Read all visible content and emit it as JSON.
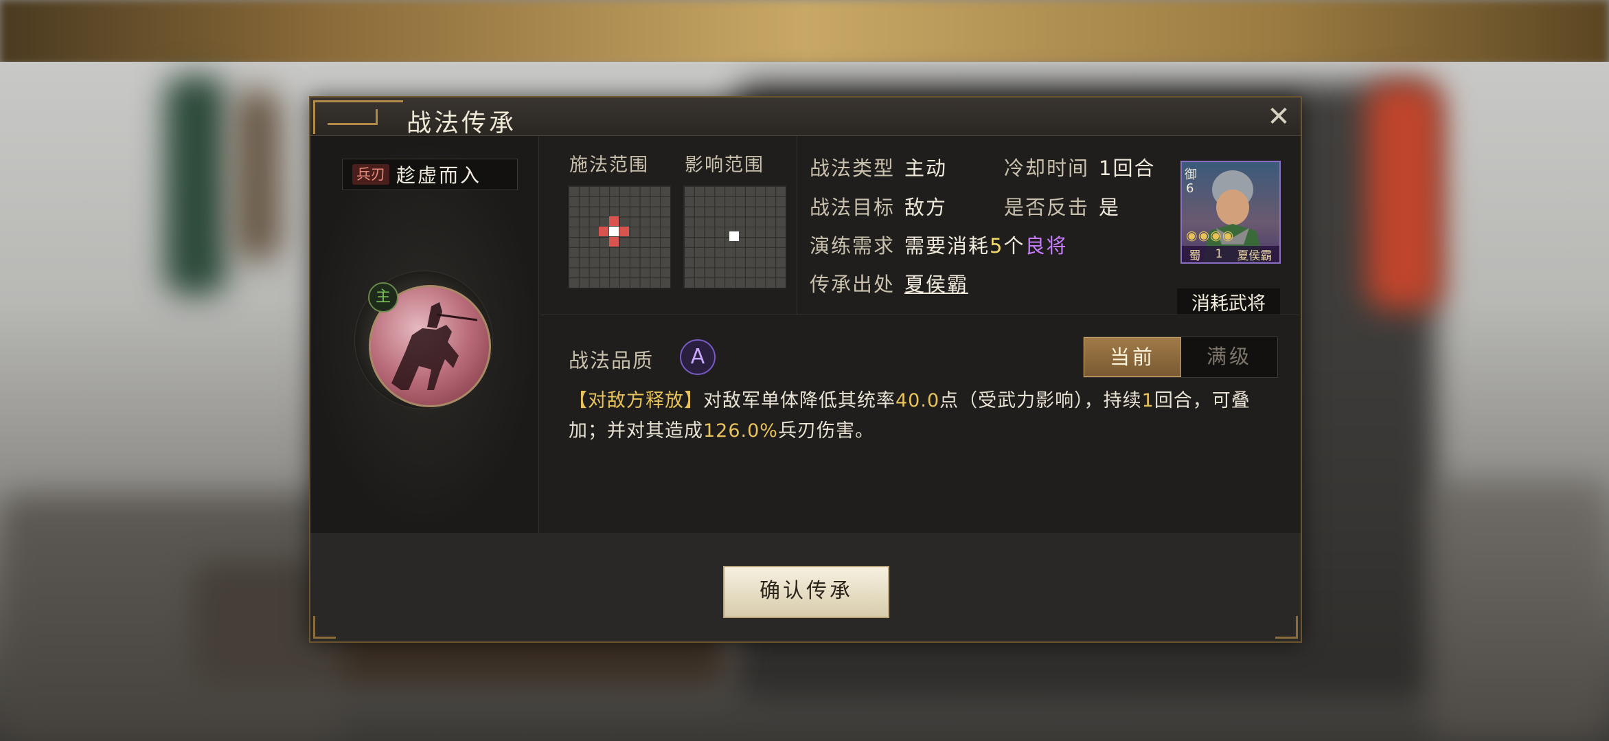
{
  "dialog": {
    "title": "战法传承",
    "close_label": "✕"
  },
  "skill": {
    "type_tag": "兵刃",
    "name": "趁虚而入",
    "main_badge": "主"
  },
  "range": {
    "cast_label": "施法范围",
    "effect_label": "影响范围"
  },
  "info": {
    "type_key": "战法类型",
    "type_val": "主动",
    "cooldown_key": "冷却时间",
    "cooldown_val": "1回合",
    "target_key": "战法目标",
    "target_val": "敌方",
    "counter_key": "是否反击",
    "counter_val": "是",
    "train_key": "演练需求",
    "train_prefix": "需要消耗",
    "train_num": "5",
    "train_mid": "个",
    "train_quality": "良将",
    "source_key": "传承出处",
    "source_val": "夏侯霸"
  },
  "general": {
    "faction": "蜀",
    "rank": "1",
    "name": "夏侯霸",
    "stars": "◉◉◉◉",
    "role_tag": "御",
    "cost": "6",
    "caption": "消耗武将"
  },
  "quality": {
    "label": "战法品质",
    "grade": "A"
  },
  "toggle": {
    "current": "当前",
    "max": "满级"
  },
  "description": {
    "tag": "【对敌方释放】",
    "p1": "对敌军单体降低其统率",
    "n1": "40.0",
    "p2": "点（受武力影响），持续",
    "n2": "1",
    "p3": "回合，可叠加；并对其造成",
    "n3": "126.0%",
    "p4": "兵刃伤害。"
  },
  "footer": {
    "confirm_label": "确认传承"
  },
  "colors": {
    "accent_gold": "#b18a48",
    "highlight_yellow": "#e8c25a",
    "quality_purple": "#c77cff"
  }
}
